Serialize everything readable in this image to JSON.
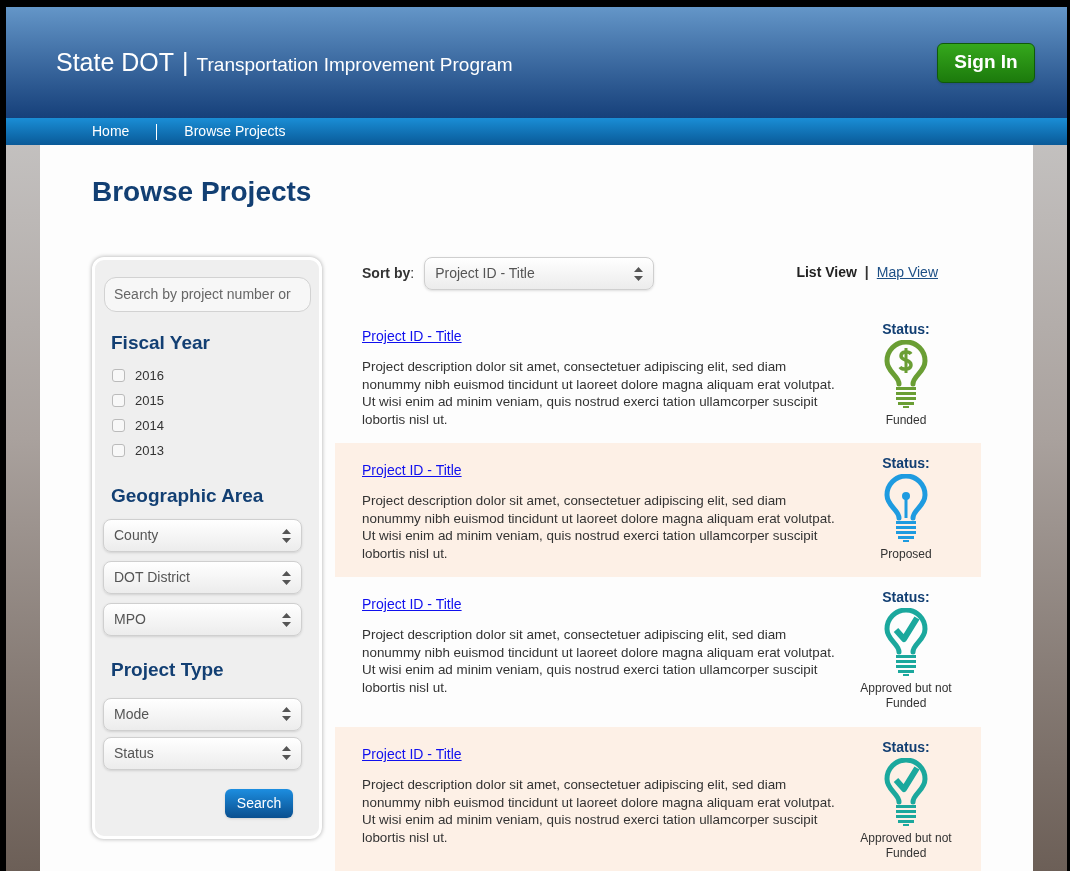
{
  "header": {
    "brand": "State DOT",
    "separator": "|",
    "subtitle": "Transportation Improvement Program",
    "sign_in": "Sign In"
  },
  "nav": [
    {
      "label": "Home"
    },
    {
      "label": "Browse Projects"
    }
  ],
  "page_title": "Browse Projects",
  "sidebar": {
    "search": {
      "placeholder": "Search by project number or"
    },
    "fiscal_year": {
      "heading": "Fiscal Year",
      "options": [
        {
          "label": "2016",
          "checked": false
        },
        {
          "label": "2015",
          "checked": false
        },
        {
          "label": "2014",
          "checked": false
        },
        {
          "label": "2013",
          "checked": false
        }
      ]
    },
    "geographic_area": {
      "heading": "Geographic Area",
      "selects": [
        "County",
        "DOT District",
        "MPO"
      ]
    },
    "project_type": {
      "heading": "Project Type",
      "selects": [
        "Mode",
        "Status"
      ]
    },
    "search_button": "Search"
  },
  "toolbar": {
    "sort_label": "Sort by",
    "sort_colon": ":",
    "sort_value": "Project ID - Title",
    "views": [
      {
        "label": "List View",
        "selected": true
      },
      {
        "label": "Map View",
        "selected": false
      }
    ],
    "view_separator": "|"
  },
  "projects": [
    {
      "title": "Project ID - Title",
      "description": "Project description dolor sit amet, consectetuer adipiscing elit, sed diam nonummy nibh euismod tincidunt ut laoreet dolore magna aliquam erat volutpat. Ut wisi enim ad minim veniam, quis nostrud exerci tation ullamcorper suscipit lobortis nisl ut.",
      "status_label": "Status:",
      "status": {
        "kind": "funded",
        "text": "Funded"
      }
    },
    {
      "title": "Project ID - Title",
      "description": "Project description dolor sit amet, consectetuer adipiscing elit, sed diam nonummy nibh euismod tincidunt ut laoreet dolore magna aliquam erat volutpat. Ut wisi enim ad minim veniam, quis nostrud exerci tation ullamcorper suscipit lobortis nisl ut.",
      "status_label": "Status:",
      "status": {
        "kind": "proposed",
        "text": "Proposed"
      }
    },
    {
      "title": "Project ID - Title",
      "description": "Project description dolor sit amet, consectetuer adipiscing elit, sed diam nonummy nibh euismod tincidunt ut laoreet dolore magna aliquam erat volutpat. Ut wisi enim ad minim veniam, quis nostrud exerci tation ullamcorper suscipit lobortis nisl ut.",
      "status_label": "Status:",
      "status": {
        "kind": "approved",
        "text": "Approved but not Funded"
      }
    },
    {
      "title": "Project ID - Title",
      "description": "Project description dolor sit amet, consectetuer adipiscing elit, sed diam nonummy nibh euismod tincidunt ut laoreet dolore magna aliquam erat volutpat. Ut wisi enim ad minim veniam, quis nostrud exerci tation ullamcorper suscipit lobortis nisl ut.",
      "status_label": "Status:",
      "status": {
        "kind": "approved",
        "text": "Approved but not Funded"
      }
    }
  ]
}
